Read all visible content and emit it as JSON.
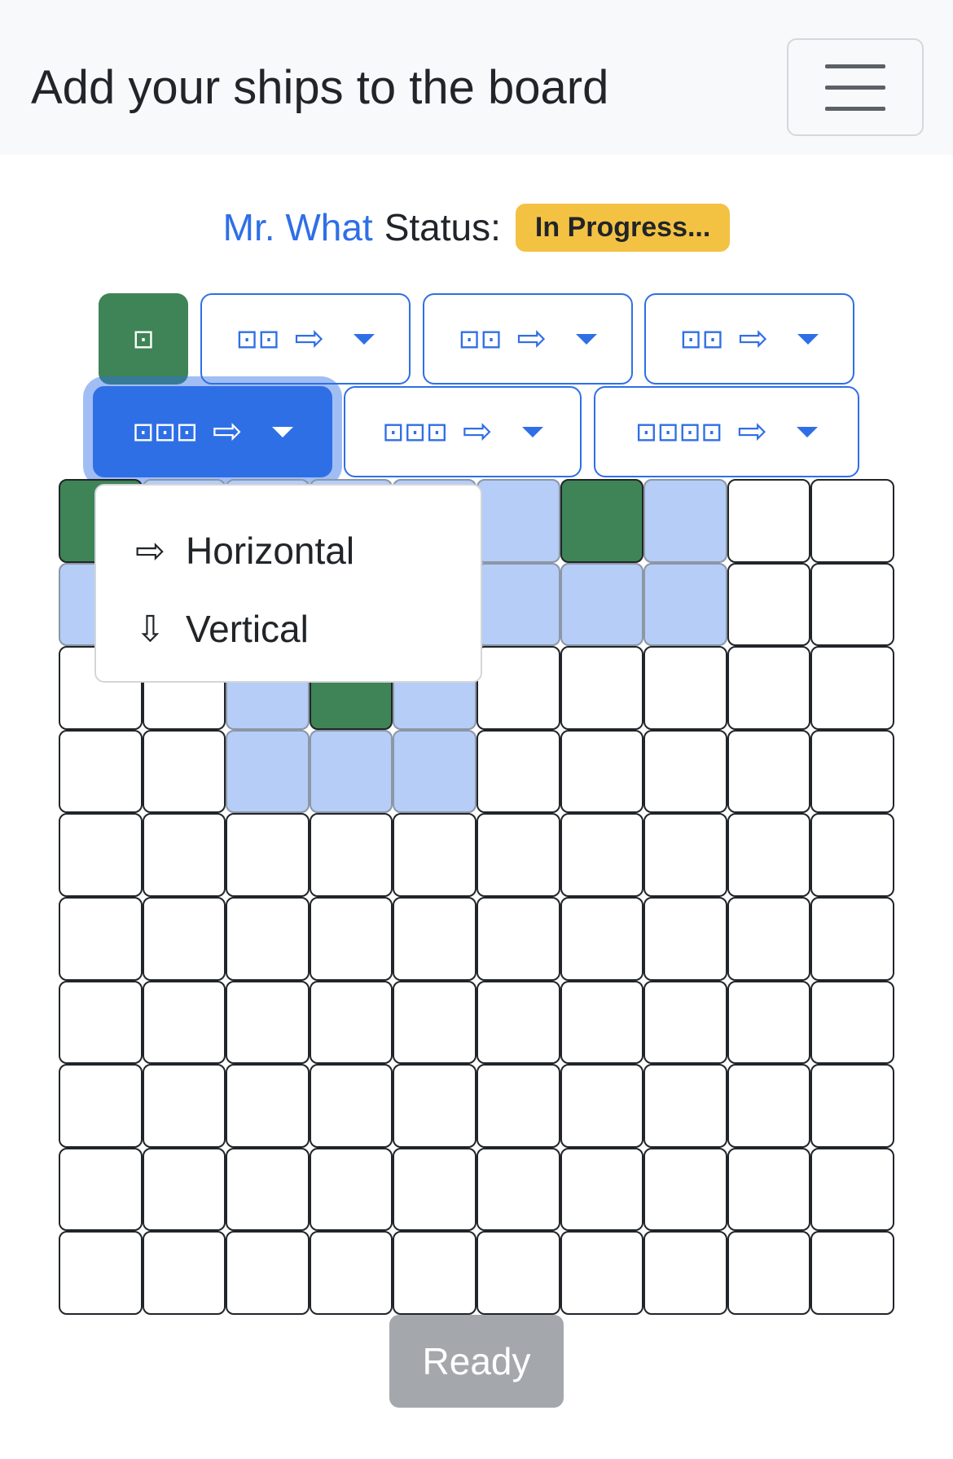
{
  "header": {
    "title": "Add your ships to the board"
  },
  "status": {
    "player_name": "Mr. What",
    "label": "Status:",
    "badge": "In Progress..."
  },
  "ships": [
    {
      "squares": "⊡",
      "state": "placed"
    },
    {
      "squares": "⊡⊡",
      "arrow": "⇨",
      "state": "default"
    },
    {
      "squares": "⊡⊡",
      "arrow": "⇨",
      "state": "default"
    },
    {
      "squares": "⊡⊡",
      "arrow": "⇨",
      "state": "default"
    },
    {
      "squares": "⊡⊡⊡",
      "arrow": "⇨",
      "state": "active"
    },
    {
      "squares": "⊡⊡⊡",
      "arrow": "⇨",
      "state": "default"
    },
    {
      "squares": "⊡⊡⊡⊡",
      "arrow": "⇨",
      "state": "default"
    }
  ],
  "orientation_menu": {
    "items": [
      {
        "icon": "⇨",
        "label": "Horizontal"
      },
      {
        "icon": "⇩",
        "label": "Vertical"
      }
    ]
  },
  "board": {
    "rows": [
      "SHHHHHSHEE",
      "HHHHHHHHEE",
      "EEHSHEEEEE",
      "EEHHHEEEEE",
      "EEEEEEEEEE",
      "EEEEEEEEEE",
      "EEEEEEEEEE",
      "EEEEEEEEEE",
      "EEEEEEEEEE",
      "EEEEEEEEEE"
    ],
    "legend": {
      "S": "ship",
      "H": "blocked",
      "E": "empty"
    }
  },
  "ready_button": {
    "label": "Ready"
  },
  "colors": {
    "primary": "#2f6fe6",
    "ship": "#3e8456",
    "blocked": "#b5cdf7",
    "badge": "#f4c243",
    "disabled": "#a4a8ad"
  }
}
